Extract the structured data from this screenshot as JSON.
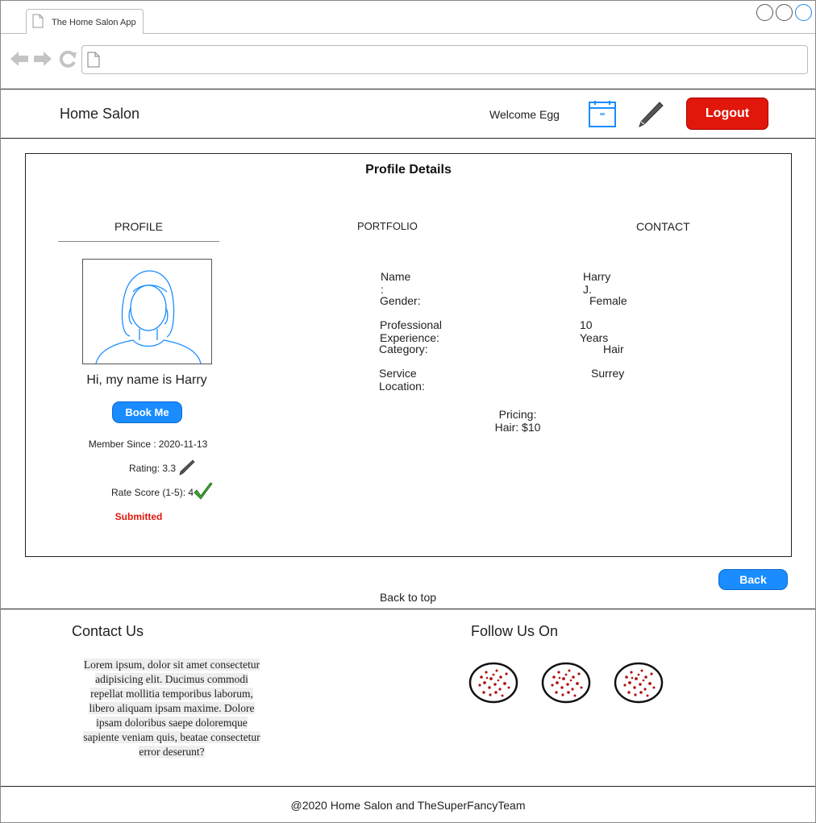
{
  "browser": {
    "tab_title": "The Home Salon App",
    "address_value": ""
  },
  "header": {
    "brand": "Home Salon",
    "welcome": "Welcome Egg",
    "logout_label": "Logout"
  },
  "profile_box": {
    "title": "Profile Details",
    "tabs": {
      "profile": "PROFILE",
      "portfolio": "PORTFOLIO",
      "contact": "CONTACT"
    },
    "greeting": "Hi, my name is Harry",
    "book_me_label": "Book Me",
    "member_since_label": "Member Since :",
    "member_since_value": "2020-11-13",
    "rating_text": "Rating: 3.3",
    "rate_score_text": "Rate Score (1-5): 4",
    "submitted_text": "Submitted",
    "details": [
      {
        "label": "Name :",
        "value": "Harry J."
      },
      {
        "label": "Gender:",
        "value": "Female"
      },
      {
        "label": "Professional Experience:",
        "value": "10 Years"
      },
      {
        "label": "Category:",
        "value": "Hair"
      },
      {
        "label": "Service Location:",
        "value": "Surrey"
      }
    ],
    "pricing_label": "Pricing:",
    "pricing_value": "Hair: $10"
  },
  "nav": {
    "back_label": "Back",
    "back_to_top": "Back to top"
  },
  "footer": {
    "contact_heading": "Contact Us",
    "follow_heading": "Follow Us On",
    "lorem": [
      "Lorem ipsum, dolor sit amet consectetur",
      "adipisicing elit. Ducimus commodi",
      "repellat mollitia temporibus laborum,",
      "libero aliquam ipsam maxime. Dolore",
      "ipsam doloribus saepe doloremque",
      "sapiente veniam quis, beatae consectetur",
      "error deserunt?"
    ],
    "social_icons": [
      "social-icon",
      "social-icon",
      "social-icon"
    ],
    "copyright": "@2020 Home Salon and TheSuperFancyTeam"
  },
  "colors": {
    "accent_blue": "#1a8cff",
    "logout_red": "#e0170a",
    "submitted_red": "#e0170a",
    "check_green": "#3da334"
  }
}
